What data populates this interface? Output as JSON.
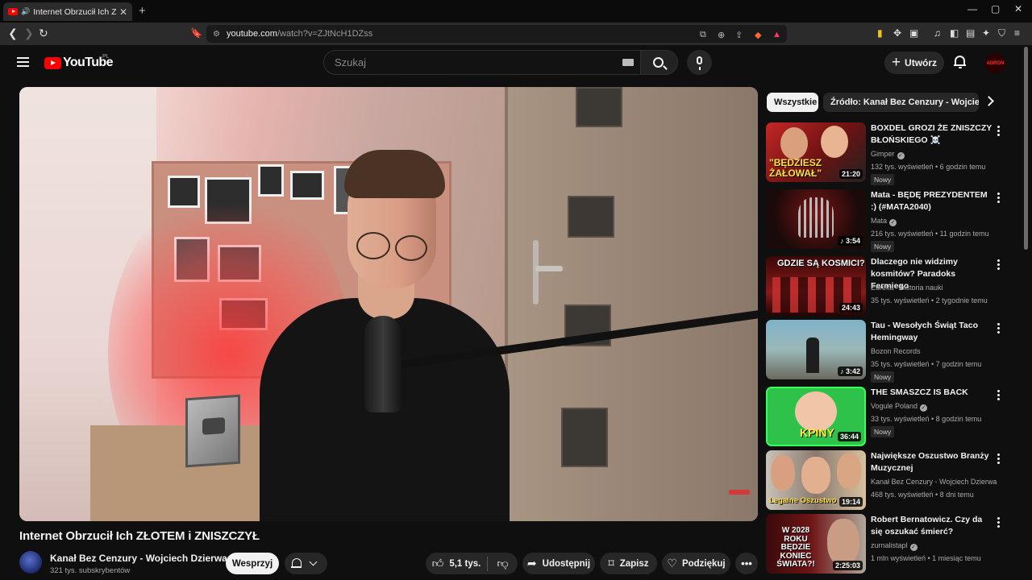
{
  "browser": {
    "tab_title": "Internet Obrzucił Ich ZŁOTEM i ZNISZCZYŁ",
    "url_host": "youtube.com",
    "url_path": "/watch?v=ZJtNcH1DZss"
  },
  "masthead": {
    "logo_text": "YouTube",
    "region": "PL",
    "search_placeholder": "Szukaj",
    "create_label": "Utwórz",
    "avatar_text": "ADRON"
  },
  "video": {
    "title": "Internet Obrzucił Ich ZŁOTEM i ZNISZCZYŁ",
    "channel": "Kanał Bez Cenzury - Wojciech Dzierwa",
    "subscribers": "321 tys. subskrybentów",
    "support_label": "Wesprzyj",
    "likes": "5,1 tys.",
    "share_label": "Udostępnij",
    "save_label": "Zapisz",
    "thanks_label": "Podziękuj"
  },
  "chips": [
    "Wszystkie",
    "Źródło: Kanał Bez Cenzury - Wojciech Dzierwa"
  ],
  "recommendations": [
    {
      "title": "BOXDEL GROZI ŻE ZNISZCZY BŁOŃSKIEGO ☠️",
      "channel": "Gimper",
      "verified": true,
      "meta": "132 tys. wyświetleń • 6 godzin temu",
      "badge": "Nowy",
      "duration": "21:20",
      "thumb_text": "\"BĘDZIESZ ŻAŁOWAŁ\""
    },
    {
      "title": "Mata - BĘDĘ PREZYDENTEM :) (#MATA2040)",
      "channel": "Mata",
      "verified": true,
      "meta": "216 tys. wyświetleń • 11 godzin temu",
      "badge": "Nowy",
      "duration": "♪ 3:54",
      "thumb_text": ""
    },
    {
      "title": "Dlaczego nie widzimy kosmitów? Paradoks Fermiego",
      "channel": "Eureka - historia nauki",
      "verified": false,
      "meta": "35 tys. wyświetleń • 2 tygodnie temu",
      "badge": "",
      "duration": "24:43",
      "thumb_text": "GDZIE SĄ KOSMICI?"
    },
    {
      "title": "Tau - Wesołych Świąt Taco Hemingway",
      "channel": "Bozon Records",
      "verified": false,
      "meta": "35 tys. wyświetleń • 7 godzin temu",
      "badge": "Nowy",
      "duration": "♪ 3:42",
      "thumb_text": ""
    },
    {
      "title": "THE SMASZCZ IS BACK",
      "channel": "Vogule Poland",
      "verified": true,
      "meta": "33 tys. wyświetleń • 8 godzin temu",
      "badge": "Nowy",
      "duration": "36:44",
      "thumb_text": "KPINY"
    },
    {
      "title": "Największe Oszustwo Branży Muzycznej",
      "channel": "Kanał Bez Cenzury - Wojciech Dzierwa",
      "verified": false,
      "meta": "468 tys. wyświetleń • 8 dni temu",
      "badge": "",
      "duration": "19:14",
      "thumb_text": "Legalne Oszustwo"
    },
    {
      "title": "Robert Bernatowicz. Czy da się oszukać śmierć?",
      "channel": "zurnalistapl",
      "verified": true,
      "meta": "1 mln wyświetleń • 1 miesiąc temu",
      "badge": "",
      "duration": "2:25:03",
      "thumb_text": "W 2028 ROKU BĘDZIE KONIEC ŚWIATA?!"
    }
  ],
  "colors": {
    "accent": "#ff0000",
    "background": "#0f0f0f",
    "chip_active": "#f1f1f1"
  }
}
